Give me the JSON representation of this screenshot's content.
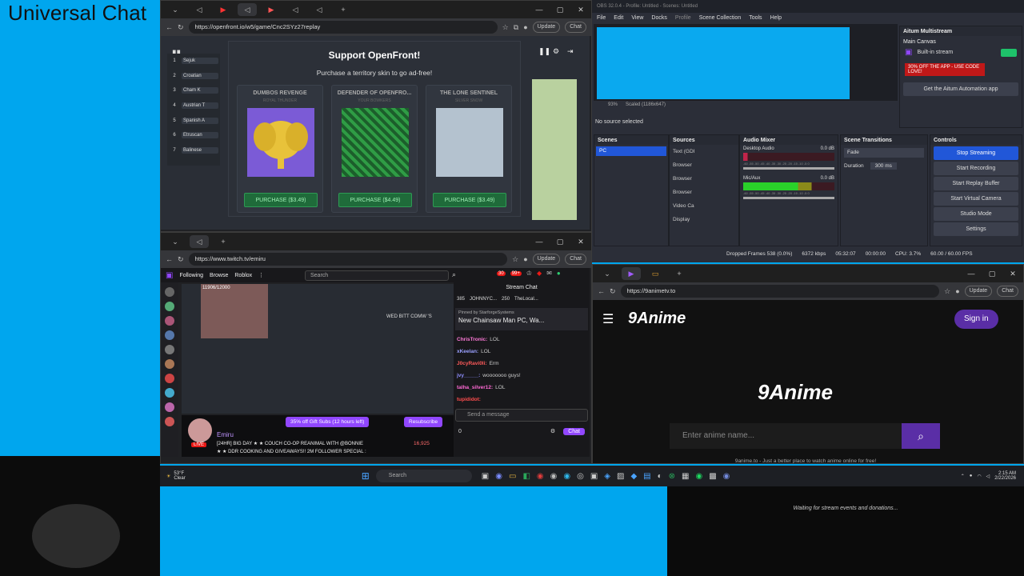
{
  "overlay": {
    "title": "Universal Chat",
    "donation_status": "Waiting for stream events and donations..."
  },
  "openfront_window": {
    "url": "https://openfront.io/w5/game/Cnc2SYz27replay",
    "update_label": "Update",
    "chat_label": "Chat",
    "leaderboard": [
      {
        "rank": "1",
        "name": "Sejuk"
      },
      {
        "rank": "2",
        "name": "Croatian"
      },
      {
        "rank": "3",
        "name": "Cham K"
      },
      {
        "rank": "4",
        "name": "Austrian T"
      },
      {
        "rank": "5",
        "name": "Spanish A"
      },
      {
        "rank": "6",
        "name": "Etruscan"
      },
      {
        "rank": "7",
        "name": "Balinese"
      }
    ],
    "modal": {
      "title": "Support OpenFront!",
      "subtitle": "Purchase a territory skin to go ad-free!",
      "skins": [
        {
          "name": "DUMBOS REVENGE",
          "sub": "ROYAL THUNDER",
          "button": "PURCHASE  ($3.49)"
        },
        {
          "name": "DEFENDER OF OPENFRO...",
          "sub": "YOUR BOWKERS",
          "button": "PURCHASE  ($4.49)"
        },
        {
          "name": "THE LONE SENTINEL",
          "sub": "SILVER SNOW",
          "button": "PURCHASE  ($3.49)"
        }
      ]
    }
  },
  "twitch_window": {
    "url": "https://www.twitch.tv/emiru",
    "update_label": "Update",
    "chat_label": "Chat",
    "nav": [
      "Following",
      "Browse",
      "Roblox"
    ],
    "search_placeholder": "Search",
    "badges": {
      "notifications": "30",
      "inbox": "99+"
    },
    "video": {
      "overlay_counter": "11906/12000",
      "caption": "WED BITT COMW 'S"
    },
    "chat": {
      "title": "Stream Chat",
      "counts": [
        "385",
        "JOHNNYC...",
        "250",
        "TheLocal..."
      ],
      "pinned_by": "Pinned by",
      "pinned_user": "StarforgeSystems",
      "pinned_text": "New Chainsaw Man PC, Wa...",
      "lines": [
        {
          "user": "ChrisTronic:",
          "msg": "LOL",
          "color": "#ff7ad9"
        },
        {
          "user": "xKeelan:",
          "msg": "LOL",
          "color": "#9aa0ff"
        },
        {
          "user": "J0cyRavi0li:",
          "msg": "Erm",
          "color": "#ff5a5a"
        },
        {
          "user": "jvy_____:",
          "msg": "wooooooo guys!",
          "color": "#8f8fff"
        },
        {
          "user": "talha_silver12:",
          "msg": "LOL",
          "color": "#ff6ad5"
        },
        {
          "user": "tupididot:",
          "msg": "",
          "color": "#ff4d4d"
        }
      ],
      "input_placeholder": "Send a message",
      "points": "0",
      "send_label": "Chat"
    },
    "streamer": {
      "name": "Emiru",
      "live": "LIVE",
      "title_1": "[24HR] BIG DAY ★ ★ COUCH CO-OP REANIMAL WITH @BONNIE",
      "title_2": "★ ★ DDR COOKING AND GIVEAWAYS!! 2M FOLLOWER SPECIAL :",
      "viewers": "16,925",
      "gift_subs": "35% off Gift Subs (12 hours left)",
      "resubscribe": "Resubscribe"
    }
  },
  "obs_window": {
    "title": "OBS 32.0.4 - Profile: Untitled - Scenes: Untitled",
    "menu": [
      "File",
      "Edit",
      "View",
      "Docks",
      "Profile",
      "Scene Collection",
      "Tools",
      "Help"
    ],
    "zoom": "93%",
    "scaled": "Scaled (1186x647)",
    "no_source": "No source selected",
    "multistream": {
      "title": "Aitum Multistream",
      "canvas": "Main Canvas",
      "builtin": "Built-in stream",
      "promo": "30% OFF THE APP - USE CODE LOVE!",
      "automation": "Get the Aitum Automation app"
    },
    "scenes": {
      "header": "Scenes",
      "items": [
        "PC"
      ]
    },
    "sources": {
      "header": "Sources",
      "items": [
        "Text (GDI",
        "Browser",
        "Browser",
        "Browser",
        "Video Ca",
        "Display"
      ]
    },
    "audio": {
      "header": "Audio Mixer",
      "tracks": [
        {
          "name": "Desktop Audio",
          "db": "0.0 dB"
        },
        {
          "name": "Mic/Aux",
          "db": "0.0 dB"
        }
      ],
      "scale": "-60 -55 -50 -45 -40 -35 -30 -25 -20 -15 -10 -5 0"
    },
    "transitions": {
      "header": "Scene Transitions",
      "type": "Fade",
      "duration_label": "Duration",
      "duration": "300 ms"
    },
    "controls": {
      "header": "Controls",
      "buttons": [
        "Stop Streaming",
        "Start Recording",
        "Start Replay Buffer",
        "Start Virtual Camera",
        "Studio Mode",
        "Settings"
      ]
    },
    "status": {
      "dropped": "Dropped Frames 538 (0.0%)",
      "kbps": "6372 kbps",
      "stream_time": "05:32:07",
      "rec_time": "00:00:00",
      "cpu": "CPU: 3.7%",
      "fps": "60.00 / 60.00 FPS"
    }
  },
  "anime_window": {
    "url": "https://9animetv.to",
    "update_label": "Update",
    "chat_label": "Chat",
    "logo": "9Anime",
    "sign_in": "Sign in",
    "search_placeholder": "Enter anime name...",
    "tagline": "9anime.to - Just a better place to watch anime online for free!"
  },
  "taskbar": {
    "weather_temp": "53°F",
    "weather_desc": "Clear",
    "search_placeholder": "Search",
    "time": "2:15 AM",
    "date": "2/22/2026"
  },
  "colors": {
    "background": "#00a6ee",
    "twitch_purple": "#9147ff",
    "obs_stop": "#2157d8",
    "anime_purple": "#5a2ea6"
  }
}
